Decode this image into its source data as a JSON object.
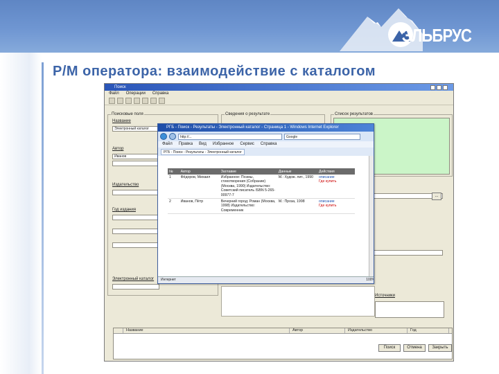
{
  "slide": {
    "title": "Р/М оператора: взаимодействие с каталогом",
    "logo_text": "ЭЛЬБРУС"
  },
  "app": {
    "window_title": "Поиск",
    "menu": [
      "Файл",
      "Операции",
      "Справка"
    ],
    "groups": {
      "search_fields": "Поисковые поля",
      "result_info": "Сведения о результате",
      "result_list": "Список результатов"
    },
    "fields": {
      "title_label": "Название",
      "title_value": "Электронный каталог",
      "author_label": "Автор",
      "author_value": "Иванов",
      "publisher_label": "Издательство",
      "year_label": "Год издания",
      "catalog_label": "Электронный каталог",
      "sources_label": "Источники"
    },
    "buttons": {
      "browse": "...",
      "search": "Поиск",
      "cancel": "Отмена",
      "close": "Закрыть"
    },
    "list_headers": [
      "",
      "Название",
      "Автор",
      "Издательство",
      "Год"
    ]
  },
  "ie": {
    "title": "РГБ - Поиск - Результаты - Электронный каталог - Страница 1 - Windows Internet Explorer",
    "address": "http://...",
    "search_box": "Google",
    "menu": [
      "Файл",
      "Правка",
      "Вид",
      "Избранное",
      "Сервис",
      "Справка"
    ],
    "tab_label": "РГБ - Поиск - Результаты - Электронный каталог",
    "table": {
      "headers": [
        "№",
        "Автор",
        "Заглавие",
        "Данные",
        "Действия"
      ],
      "rows": [
        {
          "num": "1",
          "author": "Фёдоров, Михаил",
          "title": "Избранное: Поэмы, стихотворения (Собрание) (Москва, 1990) Издательство: Советский писатель ISBN 5-265-00977-7",
          "data": "М.: Худож. лит., 1990",
          "action1": "описание",
          "action2": "Где купить"
        },
        {
          "num": "2",
          "author": "Иванов, Пётр",
          "title": "Вечерний город: Роман (Москва, 1998) Издательство: Современник",
          "data": "М.: Проза, 1998",
          "action1": "описание",
          "action2": "Где купить"
        }
      ]
    },
    "status_left": "Интернет",
    "zoom": "100%"
  },
  "colors": {
    "accent": "#3c64a8",
    "banner": "#6f96d2",
    "result_panel": "#cbf5c8"
  }
}
